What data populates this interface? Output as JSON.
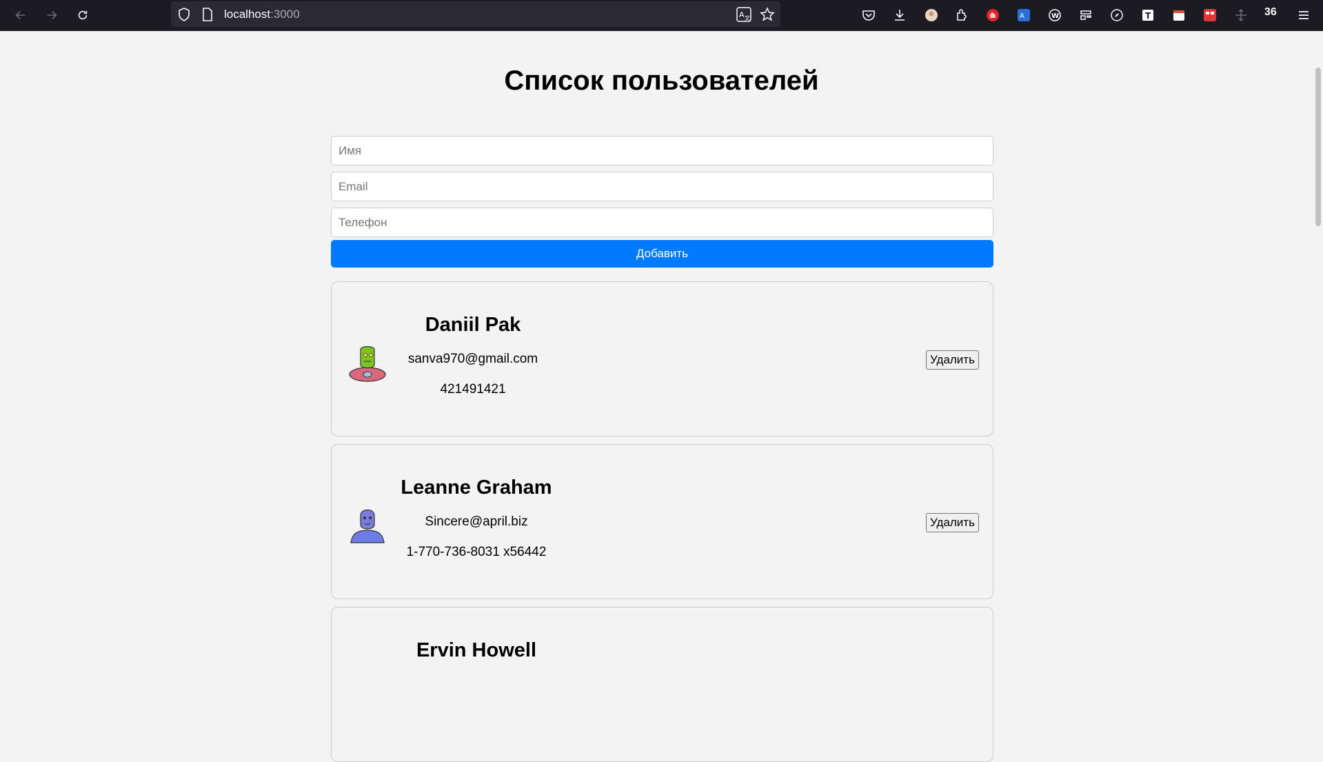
{
  "browser": {
    "url_host": "localhost",
    "url_port": ":3000",
    "badge_count": "36"
  },
  "page": {
    "title": "Список пользователей"
  },
  "form": {
    "name_placeholder": "Имя",
    "email_placeholder": "Email",
    "phone_placeholder": "Телефон",
    "add_label": "Добавить"
  },
  "users": [
    {
      "name": "Daniil Pak",
      "email": "sanva970@gmail.com",
      "phone": "421491421",
      "delete_label": "Удалить",
      "avatar_color": "#7cc520"
    },
    {
      "name": "Leanne Graham",
      "email": "Sincere@april.biz",
      "phone": "1-770-736-8031 x56442",
      "delete_label": "Удалить",
      "avatar_color": "#7b7bd9"
    },
    {
      "name": "Ervin Howell",
      "email": "",
      "phone": "",
      "delete_label": "",
      "avatar_color": ""
    }
  ],
  "colors": {
    "accent": "#007bff",
    "toolbar_bg": "#1c1b22",
    "page_bg": "#f3f3f3"
  }
}
